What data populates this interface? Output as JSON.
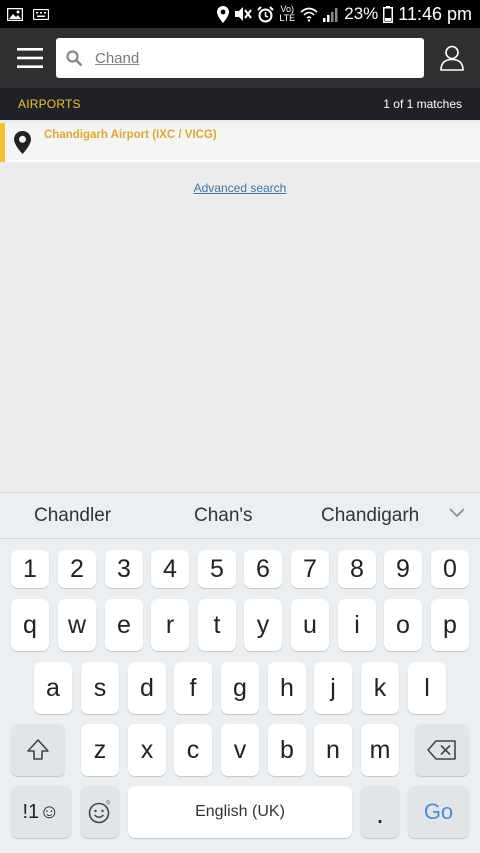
{
  "statusbar": {
    "battery_pct": "23%",
    "time": "11:46 pm",
    "volte_label": "Vo) LTE"
  },
  "search": {
    "value": "Chand",
    "placeholder": ""
  },
  "section": {
    "title": "AIRPORTS",
    "count": "1 of 1 matches"
  },
  "results": [
    {
      "label": "Chandigarh Airport (IXC / VICG)",
      "icon": "map-pin-icon"
    }
  ],
  "advanced_search_label": "Advanced search",
  "keyboard": {
    "suggestions": [
      "Chandler",
      "Chan's",
      "Chandigarh"
    ],
    "number_row": [
      "1",
      "2",
      "3",
      "4",
      "5",
      "6",
      "7",
      "8",
      "9",
      "0"
    ],
    "row1": [
      "q",
      "w",
      "e",
      "r",
      "t",
      "y",
      "u",
      "i",
      "o",
      "p"
    ],
    "row2": [
      "a",
      "s",
      "d",
      "f",
      "g",
      "h",
      "j",
      "k",
      "l"
    ],
    "row3": [
      "z",
      "x",
      "c",
      "v",
      "b",
      "n",
      "m"
    ],
    "symbols_label": "!1☺",
    "space_label": "English (UK)",
    "period_label": ".",
    "go_label": "Go"
  },
  "colors": {
    "accent": "#f3c231",
    "header_bg": "#2e2f31",
    "section_bg": "#1f2126",
    "link": "#3a78a8",
    "go_key": "#4a8fd6"
  }
}
